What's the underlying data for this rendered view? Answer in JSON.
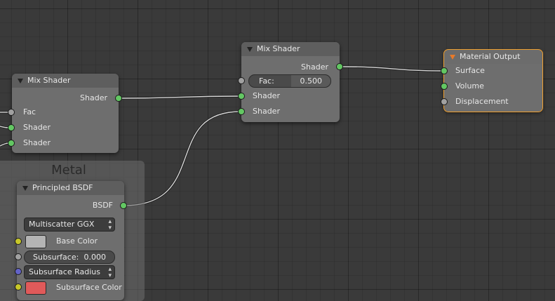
{
  "frame": {
    "label": "Metal",
    "color": "#6e6e6e"
  },
  "nodes": {
    "mix_left": {
      "title": "Mix Shader",
      "output": "Shader",
      "inputs": [
        "Fac",
        "Shader",
        "Shader"
      ]
    },
    "mix_center": {
      "title": "Mix Shader",
      "output": "Shader",
      "fac_label": "Fac:",
      "fac_value": "0.500",
      "inputs": [
        "Shader",
        "Shader"
      ]
    },
    "material_output": {
      "title": "Material Output",
      "inputs": [
        "Surface",
        "Volume",
        "Displacement"
      ],
      "selected_color": "#f0a030"
    },
    "principled": {
      "title": "Principled BSDF",
      "output": "BSDF",
      "distribution": "Multiscatter GGX",
      "base_color_label": "Base Color",
      "base_color": "#b4b4b4",
      "subsurface_label": "Subsurface:",
      "subsurface_value": "0.000",
      "subsurface_radius": "Subsurface Radius",
      "subsurface_color_label": "Subsurface Color",
      "subsurface_color": "#e05a5a"
    }
  },
  "socket_colors": {
    "shader": "#63c763",
    "float": "#a1a1a1",
    "color": "#c7c729",
    "vector": "#6363c7"
  }
}
